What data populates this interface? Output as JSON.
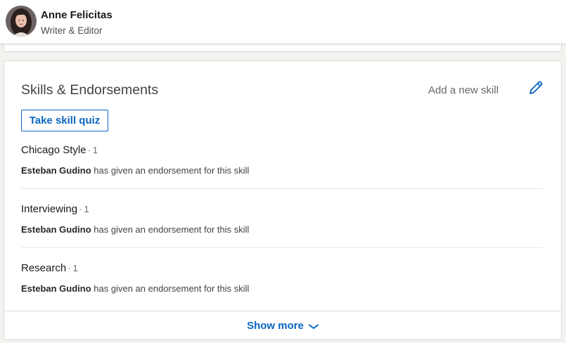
{
  "profile": {
    "name": "Anne Felicitas",
    "headline": "Writer & Editor"
  },
  "skills_section": {
    "title": "Skills & Endorsements",
    "add_skill_label": "Add a new skill",
    "edit_icon": "pencil-icon",
    "quiz_button_label": "Take skill quiz",
    "separator": "·",
    "skills": [
      {
        "name": "Chicago Style",
        "count": "1",
        "endorser": "Esteban Gudino",
        "endorse_text": "has given an endorsement for this skill"
      },
      {
        "name": "Interviewing",
        "count": "1",
        "endorser": "Esteban Gudino",
        "endorse_text": "has given an endorsement for this skill"
      },
      {
        "name": "Research",
        "count": "1",
        "endorser": "Esteban Gudino",
        "endorse_text": "has given an endorsement for this skill"
      }
    ],
    "show_more_label": "Show more",
    "show_more_icon": "chevron-down-icon"
  },
  "colors": {
    "accent": "#0a66c2",
    "background": "#f3f2ef",
    "card": "#ffffff"
  }
}
